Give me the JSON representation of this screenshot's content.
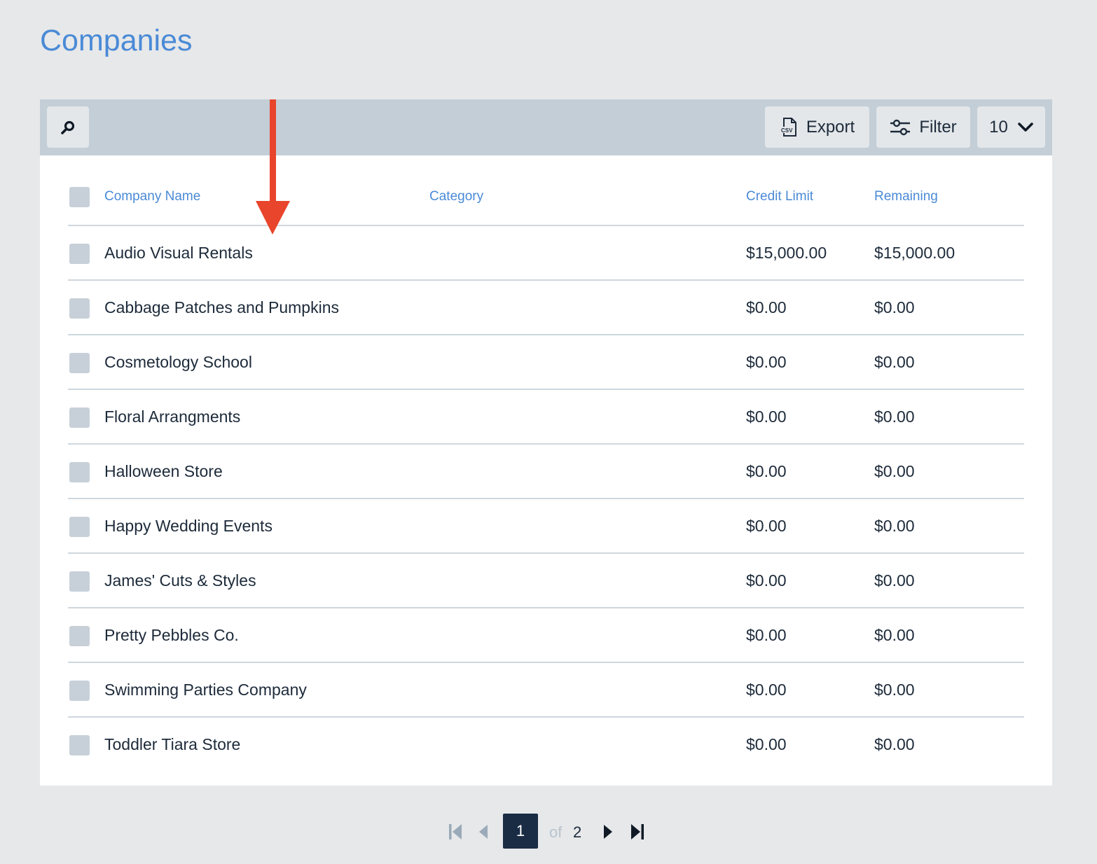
{
  "page": {
    "title": "Companies"
  },
  "toolbar": {
    "search_icon": "search-icon",
    "export_label": "Export",
    "export_icon": "csv-file-icon",
    "filter_label": "Filter",
    "filter_icon": "sliders-icon",
    "per_page_value": "10"
  },
  "table": {
    "columns": {
      "name": "Company Name",
      "category": "Category",
      "credit": "Credit Limit",
      "remaining": "Remaining"
    },
    "rows": [
      {
        "name": "Audio Visual Rentals",
        "category": "",
        "credit": "$15,000.00",
        "remaining": "$15,000.00"
      },
      {
        "name": "Cabbage Patches and Pumpkins",
        "category": "",
        "credit": "$0.00",
        "remaining": "$0.00"
      },
      {
        "name": "Cosmetology School",
        "category": "",
        "credit": "$0.00",
        "remaining": "$0.00"
      },
      {
        "name": "Floral Arrangments",
        "category": "",
        "credit": "$0.00",
        "remaining": "$0.00"
      },
      {
        "name": "Halloween Store",
        "category": "",
        "credit": "$0.00",
        "remaining": "$0.00"
      },
      {
        "name": "Happy Wedding Events",
        "category": "",
        "credit": "$0.00",
        "remaining": "$0.00"
      },
      {
        "name": "James' Cuts & Styles",
        "category": "",
        "credit": "$0.00",
        "remaining": "$0.00"
      },
      {
        "name": "Pretty Pebbles Co.",
        "category": "",
        "credit": "$0.00",
        "remaining": "$0.00"
      },
      {
        "name": "Swimming Parties Company",
        "category": "",
        "credit": "$0.00",
        "remaining": "$0.00"
      },
      {
        "name": "Toddler Tiara Store",
        "category": "",
        "credit": "$0.00",
        "remaining": "$0.00"
      }
    ]
  },
  "pagination": {
    "current": "1",
    "of_label": "of",
    "total": "2"
  },
  "colors": {
    "accent": "#4a8ad6",
    "annotation_arrow": "#e8452c",
    "toolbar_bg": "#c3ced7",
    "page_bg": "#e6e8ea",
    "current_page_bg": "#1a2c44"
  }
}
